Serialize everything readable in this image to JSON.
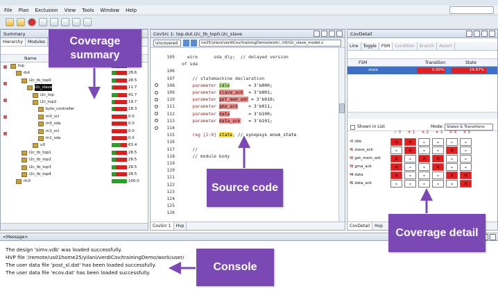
{
  "menu": [
    "File",
    "Plan",
    "Exclusion",
    "View",
    "Tools",
    "Window",
    "Help"
  ],
  "summary": {
    "title": "Summary",
    "tabs": [
      "Hierarchy",
      "Modules"
    ],
    "header": "Name",
    "rows": [
      {
        "name": "top",
        "value": "28.6",
        "ratio": 0.25
      },
      {
        "name": "dut",
        "value": "28.6",
        "ratio": 0.25
      },
      {
        "name": "i2c_tb_top0",
        "value": "28.5",
        "ratio": 0.25
      },
      {
        "name": "i2c_slave",
        "value": "11.7",
        "ratio": 0.1
      },
      {
        "name": "i2c_top",
        "value": "41.7",
        "ratio": 0.4
      },
      {
        "name": "i2c_top2",
        "value": "19.7",
        "ratio": 0.18
      },
      {
        "name": "byte_controller",
        "value": "18.3",
        "ratio": 0.17
      },
      {
        "name": "m0_scl",
        "value": "0.0",
        "ratio": 0
      },
      {
        "name": "m0_sda",
        "value": "0.0",
        "ratio": 0
      },
      {
        "name": "m1_scl",
        "value": "0.0",
        "ratio": 0
      },
      {
        "name": "m1_sda",
        "value": "0.0",
        "ratio": 0
      },
      {
        "name": "u0",
        "value": "63.4",
        "ratio": 0.6
      },
      {
        "name": "i2c_tb_top1",
        "value": "28.5",
        "ratio": 0.25
      },
      {
        "name": "i2c_tb_top2",
        "value": "28.5",
        "ratio": 0.25
      },
      {
        "name": "i2c_tb_top3",
        "value": "28.5",
        "ratio": 0.25
      },
      {
        "name": "i2c_tb_top4",
        "value": "28.5",
        "ratio": 0.25
      },
      {
        "name": "ifc0",
        "value": "100.0",
        "ratio": 1.0
      }
    ]
  },
  "source": {
    "title": "CovSrc 1: top.dut.i2c_tb_top0.i2c_slave",
    "dropdown": "Uncovered",
    "path": "ne25/yilani/verdiCov/trainingDemo/work/../rtl/i2c_slave_model.v",
    "tabs": [
      "CovSrc 1",
      "Hvp"
    ],
    "lines": [
      {
        "n": "105",
        "text": "  wire      sda_dly;  // delayed version"
      },
      {
        "n": "",
        "text": "of sda"
      },
      {
        "n": "106",
        "text": ""
      },
      {
        "n": "107",
        "text": "    // statemachine declaration"
      },
      {
        "n": "108",
        "pre": "    parameter ",
        "hl": "idle",
        "hlc": "grn",
        "post": "       = 3'b000;"
      },
      {
        "n": "109",
        "pre": "    parameter ",
        "hl": "slave_ack",
        "hlc": "red",
        "post": "  = 3'b001;"
      },
      {
        "n": "110",
        "pre": "    parameter ",
        "hl": "get_mem_adr",
        "hlc": "red",
        "post": " = 3'b010;"
      },
      {
        "n": "111",
        "pre": "    parameter ",
        "hl": "gma_ack",
        "hlc": "red",
        "post": "    = 3'b011;"
      },
      {
        "n": "112",
        "pre": "    parameter ",
        "hl": "data",
        "hlc": "red",
        "post": "       = 3'b100;"
      },
      {
        "n": "113",
        "pre": "    parameter ",
        "hl": "data_ack",
        "hlc": "red",
        "post": "   = 3'b101;"
      },
      {
        "n": "114",
        "text": ""
      },
      {
        "n": "115",
        "pre": "    reg [2:0] ",
        "hl": "state",
        "hlc": "yel",
        "post": "; // synopsys enum_state"
      },
      {
        "n": "116",
        "text": ""
      },
      {
        "n": "117",
        "text": "    //"
      },
      {
        "n": "118",
        "text": "    // module body"
      },
      {
        "n": "119",
        "text": ""
      },
      {
        "n": "120",
        "text": ""
      },
      {
        "n": "121",
        "text": ""
      },
      {
        "n": "122",
        "text": ""
      },
      {
        "n": "123",
        "text": ""
      },
      {
        "n": "124",
        "text": ""
      },
      {
        "n": "125",
        "text": ""
      },
      {
        "n": "126",
        "text": ""
      }
    ]
  },
  "detail": {
    "title": "CovDetail",
    "tabs": [
      "Line",
      "Toggle",
      "FSM",
      "Condition",
      "Branch",
      "Assert"
    ],
    "fsm_header": [
      "FSM",
      "Transition",
      "State"
    ],
    "fsm_row": {
      "name": "state",
      "trans": "0.00%",
      "state": "16.67%"
    },
    "shown_in_list": "Shown in List",
    "mode_label": "Mode:",
    "mode_value": "States & Transitions",
    "col_head": [
      "✓ 0",
      "✕ 1",
      "✕ 2",
      "✕ 3",
      "✕ 4",
      "✕ 5"
    ],
    "states": [
      "0 idle",
      "1 slave_ack",
      "2 get_mem_adr",
      "3 gma_ack",
      "4 data",
      "5 data_ack"
    ],
    "matrix": [
      [
        "r",
        "x",
        "-",
        "-",
        "-",
        "-"
      ],
      [
        "-",
        "r",
        "-",
        "-",
        "x",
        "-"
      ],
      [
        "x",
        "-",
        "r",
        "x",
        "-",
        "-"
      ],
      [
        "x",
        "-",
        "-",
        "r",
        "-",
        "-"
      ],
      [
        "x",
        "-",
        "-",
        "-",
        "r",
        "x"
      ],
      [
        "-",
        "-",
        "-",
        "-",
        "-",
        "r"
      ]
    ],
    "bottom_tabs": [
      "CovDetail",
      "Hvp"
    ]
  },
  "console": {
    "title": "<Message>",
    "lines": [
      "The design 'simv.vdb' was loaded successfully.",
      "HVP file '/remote/us01home25/yilani/verdiCov/trainingDemo/work/user/",
      "The user data file 'post_sl.dat' has been loaded successfully.",
      "The user data file 'ecov.dat' has been loaded successfully."
    ]
  },
  "callouts": {
    "summary": "Coverage summary",
    "source": "Source code",
    "detail": "Coverage detail",
    "console": "Console"
  }
}
